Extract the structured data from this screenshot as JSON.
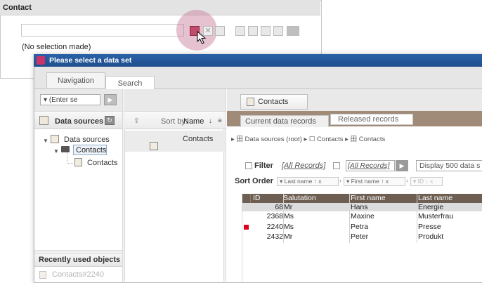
{
  "contact_panel": {
    "title": "Contact",
    "no_selection": "(No selection made)",
    "toolbar": {
      "icons": [
        "select-dataset-icon",
        "remove-icon",
        "document-icon",
        "edit-icon",
        "image-icon",
        "copy-icon",
        "list-icon",
        "image-preview-icon"
      ],
      "remove_glyph": "✕"
    }
  },
  "dialog": {
    "title": "Please select a data set",
    "tabs": {
      "navigation": "Navigation",
      "search": "Search"
    },
    "left": {
      "enter_select": "(Enter se",
      "data_sources_header": "Data sources",
      "tree": {
        "root": "Data sources",
        "folder": "Contacts",
        "leaf": "Contacts"
      },
      "recent_header": "Recently used objects",
      "recent_item": "Contacts#2240"
    },
    "middle": {
      "sort_by": "Sort by:",
      "sort_field": "Name",
      "sort_dir": "↓",
      "sort_menu": "≡",
      "item": "Contacts"
    },
    "right": {
      "contacts_button": "Contacts",
      "subtabs": {
        "current": "Current data records",
        "released": "Released records"
      },
      "breadcrumb": "▸ 田 Data sources (root)  ▸ ☐ Contacts  ▸ 田 Contacts",
      "filter": {
        "label": "Filter",
        "all_records_1": "[All Records]",
        "all_records_2": "[All Records]",
        "display": "Display 500 data s"
      },
      "sort_order": {
        "label": "Sort Order",
        "chips": [
          "▾ Last name   ↑ x",
          "▾ First name   ↑ x",
          "▾ ID   ↓ x"
        ]
      },
      "table": {
        "columns": [
          "ID",
          "Salutation",
          "First name",
          "Last name"
        ],
        "rows": [
          {
            "id": "68",
            "salutation": "Mr",
            "first": "Hans",
            "last": "Energie"
          },
          {
            "id": "2368",
            "salutation": "Ms",
            "first": "Maxine",
            "last": "Musterfrau"
          },
          {
            "id": "2240",
            "salutation": "Ms",
            "first": "Petra",
            "last": "Presse"
          },
          {
            "id": "2432",
            "salutation": "Mr",
            "first": "Peter",
            "last": "Produkt"
          }
        ]
      }
    }
  },
  "colors": {
    "titlebar": "#2b62a8",
    "accent": "#c24a6a",
    "table_header": "#6e5f52",
    "subtab_bar": "#a08b78",
    "marker": "#e0001b"
  }
}
